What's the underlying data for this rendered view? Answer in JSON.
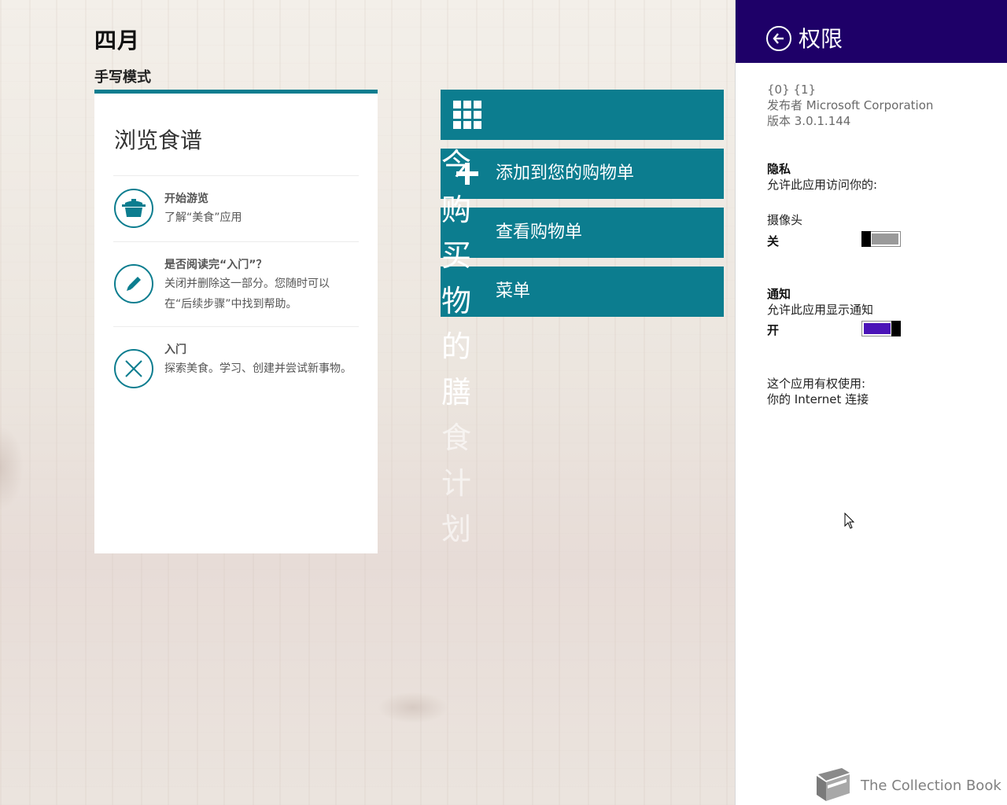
{
  "header": {
    "title": "四月",
    "subtitle": "手写模式"
  },
  "card": {
    "title": "浏览食谱",
    "items": [
      {
        "title": "开始游览",
        "desc": "了解“美食”应用",
        "icon": "pot-icon"
      },
      {
        "title": "是否阅读完“入门”？",
        "desc": "关闭并删除这一部分。您随时可以在“后续步骤”中找到帮助。",
        "icon": "pencil-icon"
      },
      {
        "title": "入门",
        "desc": "探索美食。学习、创建并尝试新事物。",
        "icon": "close-icon"
      }
    ]
  },
  "tiles": {
    "add_to_list": "添加到您的购物单",
    "view_list": "查看购物单",
    "menu": "菜单",
    "vertical_text": [
      "今",
      "购",
      "买",
      "物",
      "的",
      "膳",
      "食",
      "计",
      "划"
    ]
  },
  "pane": {
    "title": "权限",
    "meta": [
      "{0} {1}",
      "发布者 Microsoft Corporation",
      "版本 3.0.1.144"
    ],
    "privacy_title": "隐私",
    "privacy_desc": "允许此应用访问你的:",
    "camera_title": "摄像头",
    "camera_state": "关",
    "camera_on": false,
    "notify_title": "通知",
    "notify_desc": "允许此应用显示通知",
    "notify_state": "开",
    "notify_on": true,
    "capabilities_title": "这个应用有权使用:",
    "capabilities_item": "你的 Internet 连接",
    "brand": "The Collection Book"
  },
  "colors": {
    "accent_teal": "#0c7d8f",
    "pane_header": "#1e0068",
    "toggle_on": "#4b14b8",
    "toggle_off": "#9a9a9a"
  }
}
